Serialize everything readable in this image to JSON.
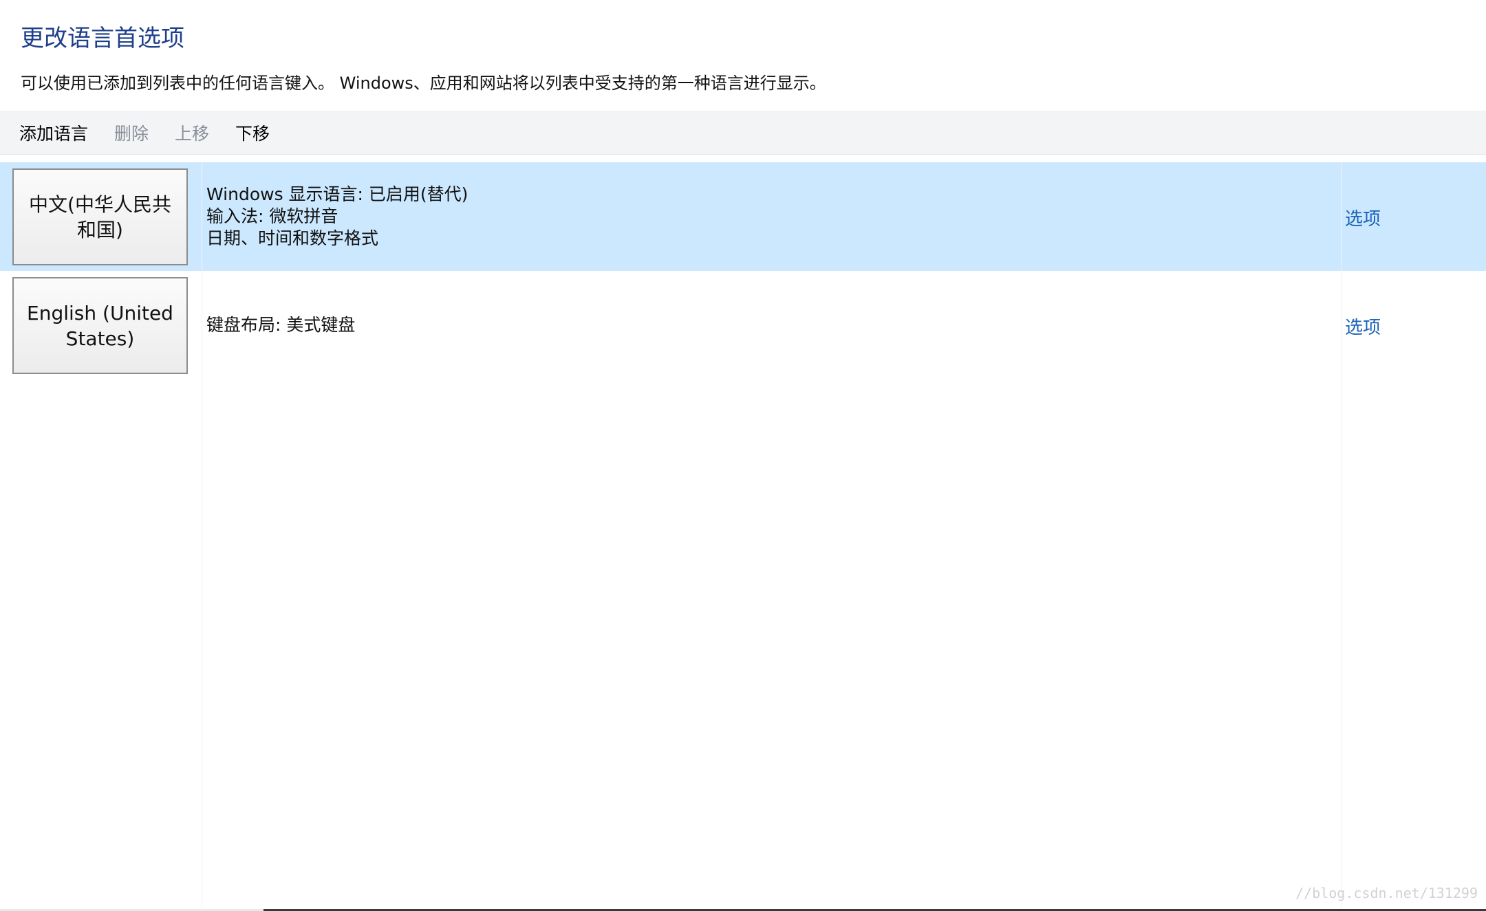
{
  "header": {
    "title": "更改语言首选项",
    "description": "可以使用已添加到列表中的任何语言键入。 Windows、应用和网站将以列表中受支持的第一种语言进行显示。"
  },
  "toolbar": {
    "add_language": "添加语言",
    "remove": "删除",
    "move_up": "上移",
    "move_down": "下移"
  },
  "languages": [
    {
      "name": "中文(中华人民共和国)",
      "details": [
        "Windows 显示语言: 已启用(替代)",
        "输入法: 微软拼音",
        "日期、时间和数字格式"
      ],
      "options_label": "选项",
      "selected": true
    },
    {
      "name": "English (United States)",
      "details": [
        "键盘布局: 美式键盘"
      ],
      "options_label": "选项",
      "selected": false
    }
  ],
  "watermark": "//blog.csdn.net/131299",
  "colors": {
    "title": "#1e3f8a",
    "selected_row": "#cce8fe",
    "link": "#1a62b8",
    "disabled_text": "#8a8f99",
    "toolbar_bg": "#f3f4f6"
  }
}
